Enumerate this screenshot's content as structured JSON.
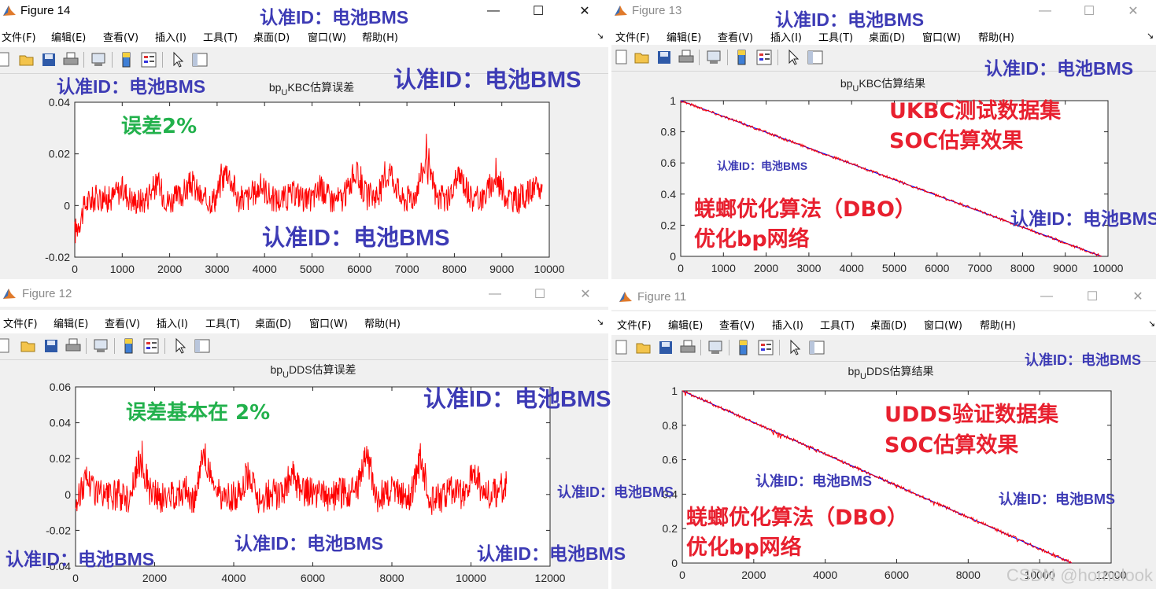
{
  "menu": [
    "文件(F)",
    "编辑(E)",
    "查看(V)",
    "插入(I)",
    "工具(T)",
    "桌面(D)",
    "窗口(W)",
    "帮助(H)"
  ],
  "dock_icon": "↘",
  "window_controls": {
    "minimize": "—",
    "maximize": "☐",
    "close": "✕"
  },
  "watermark_text": "认准ID：电池BMS",
  "csdn": "CSDN @homelook",
  "colors": {
    "error_line": "#ff0000",
    "estimate_line": "#ff0000",
    "true_line": "#0000ff",
    "watermark": "#3d3bb5",
    "annotation_green": "#22b14c",
    "annotation_red": "#e8202f"
  },
  "figures": [
    {
      "id": "fig14",
      "title": "Figure 14",
      "active": true,
      "chart_data": {
        "type": "line",
        "title_prefix": "bp",
        "title_sub": "U",
        "title_main": "KBC估算误差",
        "xlim": [
          0,
          10000
        ],
        "ylim": [
          -0.02,
          0.04
        ],
        "xticks": [
          "0",
          "1000",
          "2000",
          "3000",
          "4000",
          "5000",
          "6000",
          "7000",
          "8000",
          "9000",
          "10000"
        ],
        "yticks": [
          "-0.02",
          "0",
          "0.02",
          "0.04"
        ],
        "x_end": 9850,
        "series": [
          {
            "color": "#ff0000",
            "values": [
              -0.019,
              0.002,
              0.006,
              0.004,
              0.012,
              0.003,
              0.004,
              0.015,
              0.003,
              0.006,
              0.016,
              0.003,
              0.005,
              0.026,
              0.004,
              0.006,
              0.014,
              0.004,
              0.005,
              0.009,
              0.002,
              0.012,
              0.004,
              0.005,
              0.024,
              0.006,
              0.008,
              0.025,
              0.004,
              0.006,
              0.03,
              0.005,
              0.004,
              0.021,
              0.004,
              0.006,
              0.019,
              0.006,
              0.004,
              0.01,
              0.012
            ]
          }
        ]
      }
    },
    {
      "id": "fig13",
      "title": "Figure 13",
      "active": false,
      "chart_data": {
        "type": "line",
        "title_prefix": "bp",
        "title_sub": "U",
        "title_main": "KBC估算结果",
        "xlim": [
          0,
          10000
        ],
        "ylim": [
          0,
          1
        ],
        "xticks": [
          "0",
          "1000",
          "2000",
          "3000",
          "4000",
          "5000",
          "6000",
          "7000",
          "8000",
          "9000",
          "10000"
        ],
        "yticks": [
          "0",
          "0.2",
          "0.4",
          "0.6",
          "0.8",
          "1"
        ],
        "series": [
          {
            "color": "#0000ff",
            "points": [
              [
                0,
                1
              ],
              [
                9850,
                0
              ]
            ]
          },
          {
            "color": "#ff0000",
            "points": [
              [
                0,
                1
              ],
              [
                9850,
                0
              ]
            ]
          }
        ]
      }
    },
    {
      "id": "fig12",
      "title": "Figure 12",
      "active": false,
      "chart_data": {
        "type": "line",
        "title_prefix": "bp",
        "title_sub": "U",
        "title_main": "DDS估算误差",
        "xlim": [
          0,
          12000
        ],
        "ylim": [
          -0.04,
          0.06
        ],
        "xticks": [
          "0",
          "2000",
          "4000",
          "6000",
          "8000",
          "10000",
          "12000"
        ],
        "yticks": [
          "-0.04",
          "-0.02",
          "0",
          "0.02",
          "0.04",
          "0.06"
        ],
        "x_end": 10900,
        "series": [
          {
            "color": "#ff0000",
            "values": [
              -0.01,
              0.018,
              0.002,
              -0.004,
              0.0,
              -0.003,
              0.036,
              0.002,
              -0.005,
              0.0,
              0.005,
              -0.004,
              0.038,
              0.004,
              -0.005,
              -0.002,
              0.022,
              -0.005,
              0.001,
              -0.002,
              0.022,
              0.0,
              0.003,
              -0.002,
              -0.002,
              0.004,
              0.0,
              0.042,
              -0.004,
              0.005,
              0.004,
              -0.004,
              0.037,
              -0.007,
              -0.004,
              0.004,
              0.0,
              0.022,
              -0.002,
              0.002,
              0.01
            ]
          }
        ]
      }
    },
    {
      "id": "fig11",
      "title": "Figure 11",
      "active": false,
      "chart_data": {
        "type": "line",
        "title_prefix": "bp",
        "title_sub": "U",
        "title_main": "DDS估算结果",
        "xlim": [
          0,
          12000
        ],
        "ylim": [
          0,
          1
        ],
        "xticks": [
          "0",
          "2000",
          "4000",
          "6000",
          "8000",
          "10000",
          "12000"
        ],
        "yticks": [
          "0",
          "0.2",
          "0.4",
          "0.6",
          "0.8",
          "1"
        ],
        "series": [
          {
            "color": "#0000ff",
            "points": [
              [
                0,
                1
              ],
              [
                10900,
                0
              ]
            ]
          },
          {
            "color": "#ff0000",
            "points": [
              [
                0,
                1
              ],
              [
                10900,
                0
              ]
            ]
          }
        ]
      }
    }
  ],
  "annotations": {
    "fig14_green": "误差2%",
    "fig13_red1": "UKBC测试数据集",
    "fig13_red2": "SOC估算效果",
    "fig13_red3": "蜣螂优化算法（DBO）",
    "fig13_red4": "优化bp网络",
    "fig12_green": "误差基本在 2%",
    "fig11_red1": "UDDS验证数据集",
    "fig11_red2": "SOC估算效果",
    "fig11_red3": "蜣螂优化算法（DBO）",
    "fig11_red4": "优化bp网络"
  }
}
